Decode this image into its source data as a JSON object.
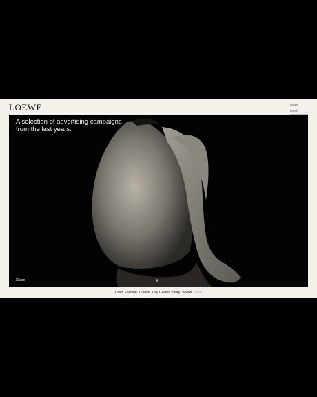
{
  "brand": {
    "logo": "LOEWE"
  },
  "header": {
    "region_select": "Europe",
    "language_select": "English"
  },
  "hero": {
    "headline": "A selection of advertising campaigns from the last years.",
    "share_label": "Share"
  },
  "nav": {
    "items": [
      {
        "label": "Craft",
        "dim": false
      },
      {
        "label": "Fashion",
        "dim": false
      },
      {
        "label": "Culture",
        "dim": false
      },
      {
        "label": "City Guides",
        "dim": false
      },
      {
        "label": "Story",
        "dim": false
      },
      {
        "label": "Books",
        "dim": false
      },
      {
        "label": "Shop",
        "dim": true
      }
    ]
  },
  "colors": {
    "page_bg": "#f4f1ea",
    "hero_bg": "#030303",
    "text": "#111111"
  }
}
